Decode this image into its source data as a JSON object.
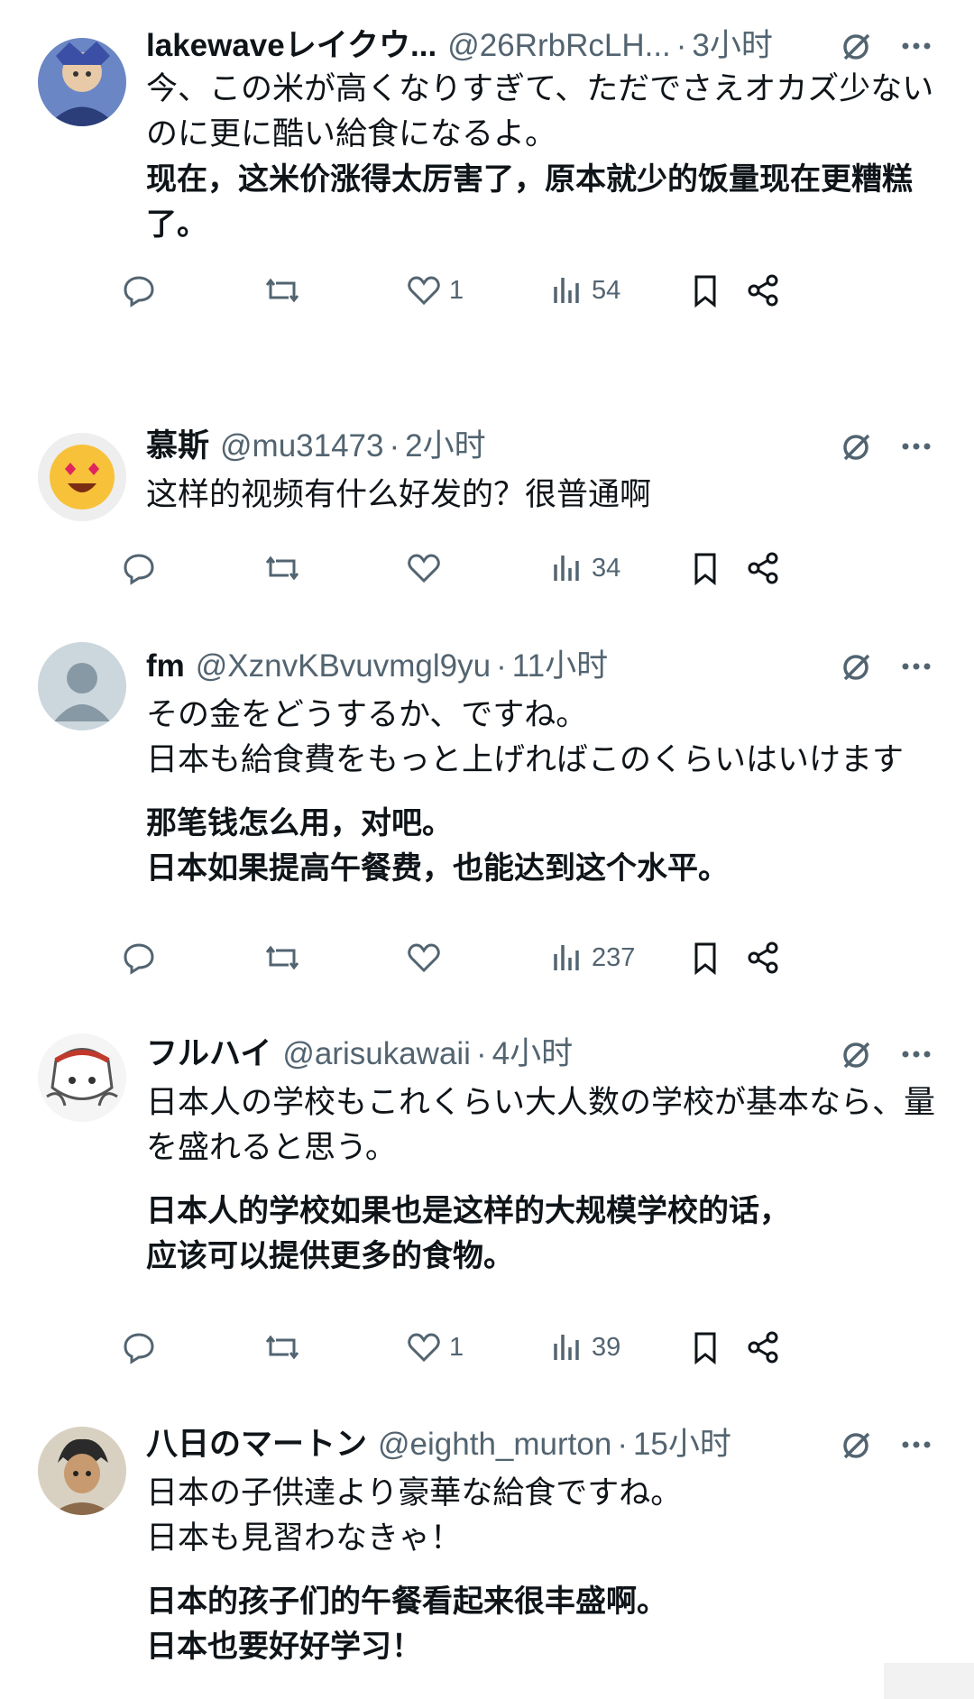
{
  "colors": {
    "text": "#0f1419",
    "secondary": "#536471",
    "background": "#ffffff"
  },
  "replies": [
    {
      "name": "lakewaveレイクウ...",
      "handle": "@26RrbRcLH...",
      "dot": "·",
      "time": "3小时",
      "text": "今、この米が高くなりすぎて、ただでさえオカズ少ないのに更に酷い給食になるよ。",
      "translation": "现在，这米价涨得太厉害了，原本就少的饭量现在更糟糕了。",
      "likes": "1",
      "views": "54"
    },
    {
      "name": "慕斯",
      "handle": "@mu31473",
      "dot": "·",
      "time": "2小时",
      "text": "这样的视频有什么好发的？很普通啊",
      "translation": "",
      "likes": "",
      "views": "34"
    },
    {
      "name": "fm",
      "handle": "@XznvKBvuvmgl9yu",
      "dot": "·",
      "time": "11小时",
      "text": "その金をどうするか、ですね。\n日本も給食費をもっと上げればこのくらいはいけます",
      "translation": "那笔钱怎么用，对吧。\n日本如果提高午餐费，也能达到这个水平。",
      "likes": "",
      "views": "237"
    },
    {
      "name": "フルハイ",
      "handle": "@arisukawaii",
      "dot": "·",
      "time": "4小时",
      "text": "日本人の学校もこれくらい大人数の学校が基本なら、量を盛れると思う。",
      "translation": "日本人的学校如果也是这样的大规模学校的话，\n应该可以提供更多的食物。",
      "likes": "1",
      "views": "39"
    },
    {
      "name": "八日のマートン",
      "handle": "@eighth_murton",
      "dot": "·",
      "time": "15小时",
      "text": "日本の子供達より豪華な給食ですね。\n日本も見習わなきゃ！",
      "translation": "日本的孩子们的午餐看起来很丰盛啊。\n日本也要好好学习！",
      "likes": "",
      "views": ""
    }
  ]
}
